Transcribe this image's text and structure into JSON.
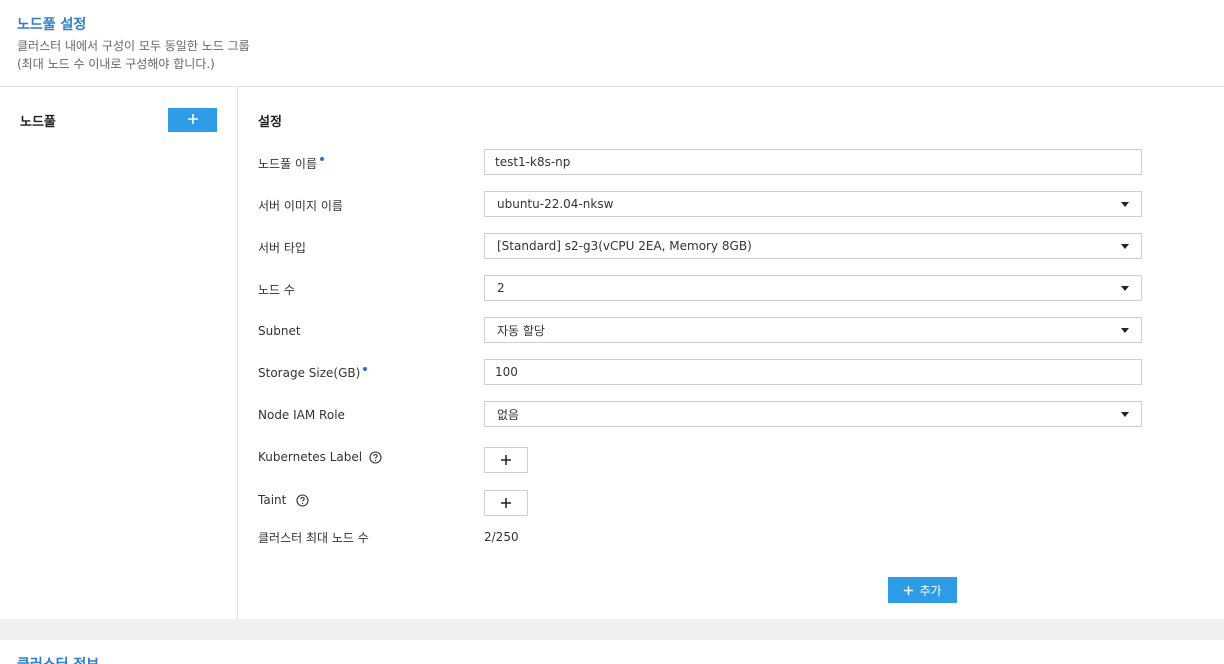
{
  "header": {
    "title": "노드풀 설정",
    "desc_line1": "클러스터 내에서 구성이 모두 동일한 노드 그룹",
    "desc_line2": "(최대 노드 수 이내로 구성해야 합니다.)"
  },
  "nodepool": {
    "title": "노드풀",
    "add_button_icon": "plus-icon"
  },
  "settings": {
    "title": "설정",
    "name_label": "노드풀 이름",
    "name_value": "test1-k8s-np",
    "image_label": "서버 이미지 이름",
    "image_value": "ubuntu-22.04-nksw",
    "type_label": "서버 타입",
    "type_value": "[Standard] s2-g3(vCPU 2EA, Memory 8GB)",
    "count_label": "노드 수",
    "count_value": "2",
    "subnet_label": "Subnet",
    "subnet_value": "자동 할당",
    "storage_label": "Storage Size(GB)",
    "storage_value": "100",
    "iam_label": "Node IAM Role",
    "iam_value": "없음",
    "k8s_label_label": "Kubernetes Label",
    "taint_label": "Taint",
    "max_nodes_label": "클러스터 최대 노드 수",
    "max_nodes_value": "2/250",
    "add_button_label": "추가"
  },
  "footer": {
    "title": "클러스터 정보"
  },
  "colors": {
    "accent": "#2d9be6",
    "title_blue": "#2f7ec9",
    "required_dot": "#2f6fd8"
  }
}
